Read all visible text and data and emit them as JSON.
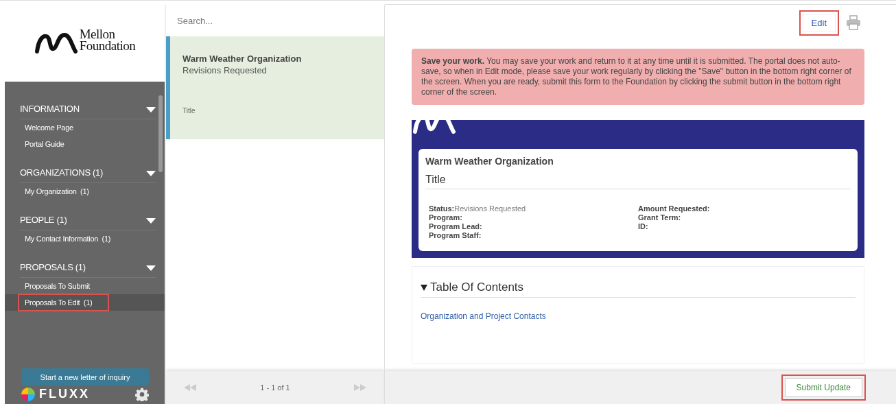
{
  "logo": {
    "line_1": "Mellon",
    "line_2": "Foundation"
  },
  "sidebar": {
    "sections": [
      {
        "title": "INFORMATION",
        "expanded": true,
        "items": [
          {
            "label": "Welcome Page",
            "selected": false,
            "annotated": false
          },
          {
            "label": "Portal Guide",
            "selected": false,
            "annotated": false
          }
        ]
      },
      {
        "title": "ORGANIZATIONS (1)",
        "expanded": true,
        "items": [
          {
            "label": "My Organization  (1)",
            "selected": false,
            "annotated": false
          }
        ]
      },
      {
        "title": "PEOPLE (1)",
        "expanded": true,
        "items": [
          {
            "label": "My Contact Information  (1)",
            "selected": false,
            "annotated": false
          }
        ]
      },
      {
        "title": "PROPOSALS (1)",
        "expanded": true,
        "items": [
          {
            "label": "Proposals To Submit",
            "selected": false,
            "annotated": false
          },
          {
            "label": "Proposals To Edit  (1)",
            "selected": true,
            "annotated": true
          }
        ]
      }
    ],
    "new_button": "Start a new letter of inquiry",
    "brand": "FLUXX"
  },
  "list": {
    "search": {
      "placeholder": "Search..."
    },
    "items": [
      {
        "title": "Warm Weather Organization",
        "status": "Revisions Requested",
        "subtitle": "Title",
        "selected": true
      }
    ],
    "pager": "1 - 1 of 1"
  },
  "detail": {
    "edit_button": {
      "label": "Edit",
      "annotated": true
    },
    "alert": "**Save your work.** You may save your work and return to it at any time until it is submitted. The portal does not auto-save, so when in Edit mode, please save your work regularly by clicking the \"Save\" button in the bottom right corner of the screen.  When you are ready, submit this form to the Foundation by clicking the submit button in the bottom right corner of the screen.",
    "card": {
      "organization": "Warm Weather Organization",
      "title": "Title",
      "fields_left": [
        {
          "label": "Status:",
          "value": "Revisions Requested"
        },
        {
          "label": "Program:"
        },
        {
          "label": "Program Lead:"
        },
        {
          "label": "Program Staff:"
        }
      ],
      "fields_right": [
        {
          "label": "Amount Requested:"
        },
        {
          "label": "Grant Term:"
        },
        {
          "label": "ID:"
        }
      ]
    },
    "toc": {
      "heading": "Table Of Contents",
      "expanded": true,
      "links": [
        "Organization and Project Contacts"
      ]
    },
    "submit_button": {
      "label": "Submit Update",
      "annotated": true
    }
  }
}
